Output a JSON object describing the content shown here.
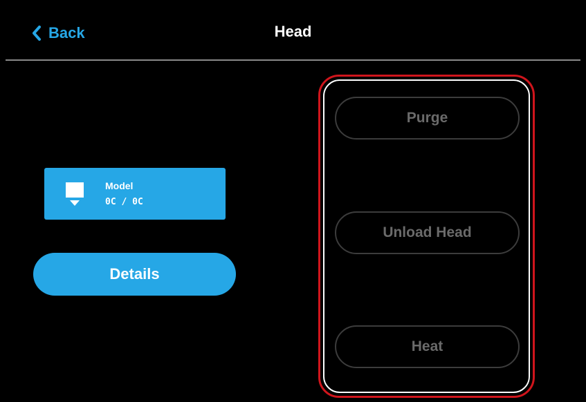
{
  "header": {
    "back_label": "Back",
    "title": "Head"
  },
  "model_card": {
    "label": "Model",
    "temperature": "0C / 0C",
    "icon": "print-head-icon"
  },
  "details_button": {
    "label": "Details"
  },
  "actions": {
    "purge_label": "Purge",
    "unload_label": "Unload Head",
    "heat_label": "Heat",
    "state": "disabled"
  },
  "colors": {
    "accent": "#26a7e6",
    "background": "#000000",
    "disabled_text": "#6a6a6a",
    "highlight": "#d0151c"
  }
}
